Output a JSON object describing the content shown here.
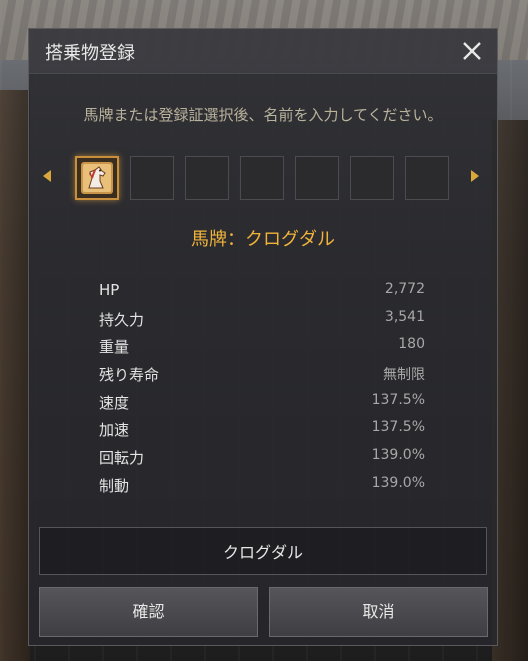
{
  "dialog": {
    "title": "搭乗物登録",
    "instruction": "馬牌または登録証選択後、名前を入力してください。",
    "close_icon": "close-icon"
  },
  "slots": {
    "count": 7,
    "selected_index": 0,
    "selected_icon": "horse-tag-icon"
  },
  "horse": {
    "name_label": "馬牌：クログダル"
  },
  "stats": [
    {
      "label": "HP",
      "value": "2,772"
    },
    {
      "label": "持久力",
      "value": "3,541"
    },
    {
      "label": "重量",
      "value": "180"
    },
    {
      "label": "残り寿命",
      "value": "無制限"
    },
    {
      "label": "速度",
      "value": "137.5%"
    },
    {
      "label": "加速",
      "value": "137.5%"
    },
    {
      "label": "回転力",
      "value": "139.0%"
    },
    {
      "label": "制動",
      "value": "139.0%"
    }
  ],
  "name_input": {
    "value": "クログダル"
  },
  "buttons": {
    "confirm": "確認",
    "cancel": "取消"
  },
  "colors": {
    "accent": "#f0b43b",
    "instruction": "#b9b29c"
  }
}
